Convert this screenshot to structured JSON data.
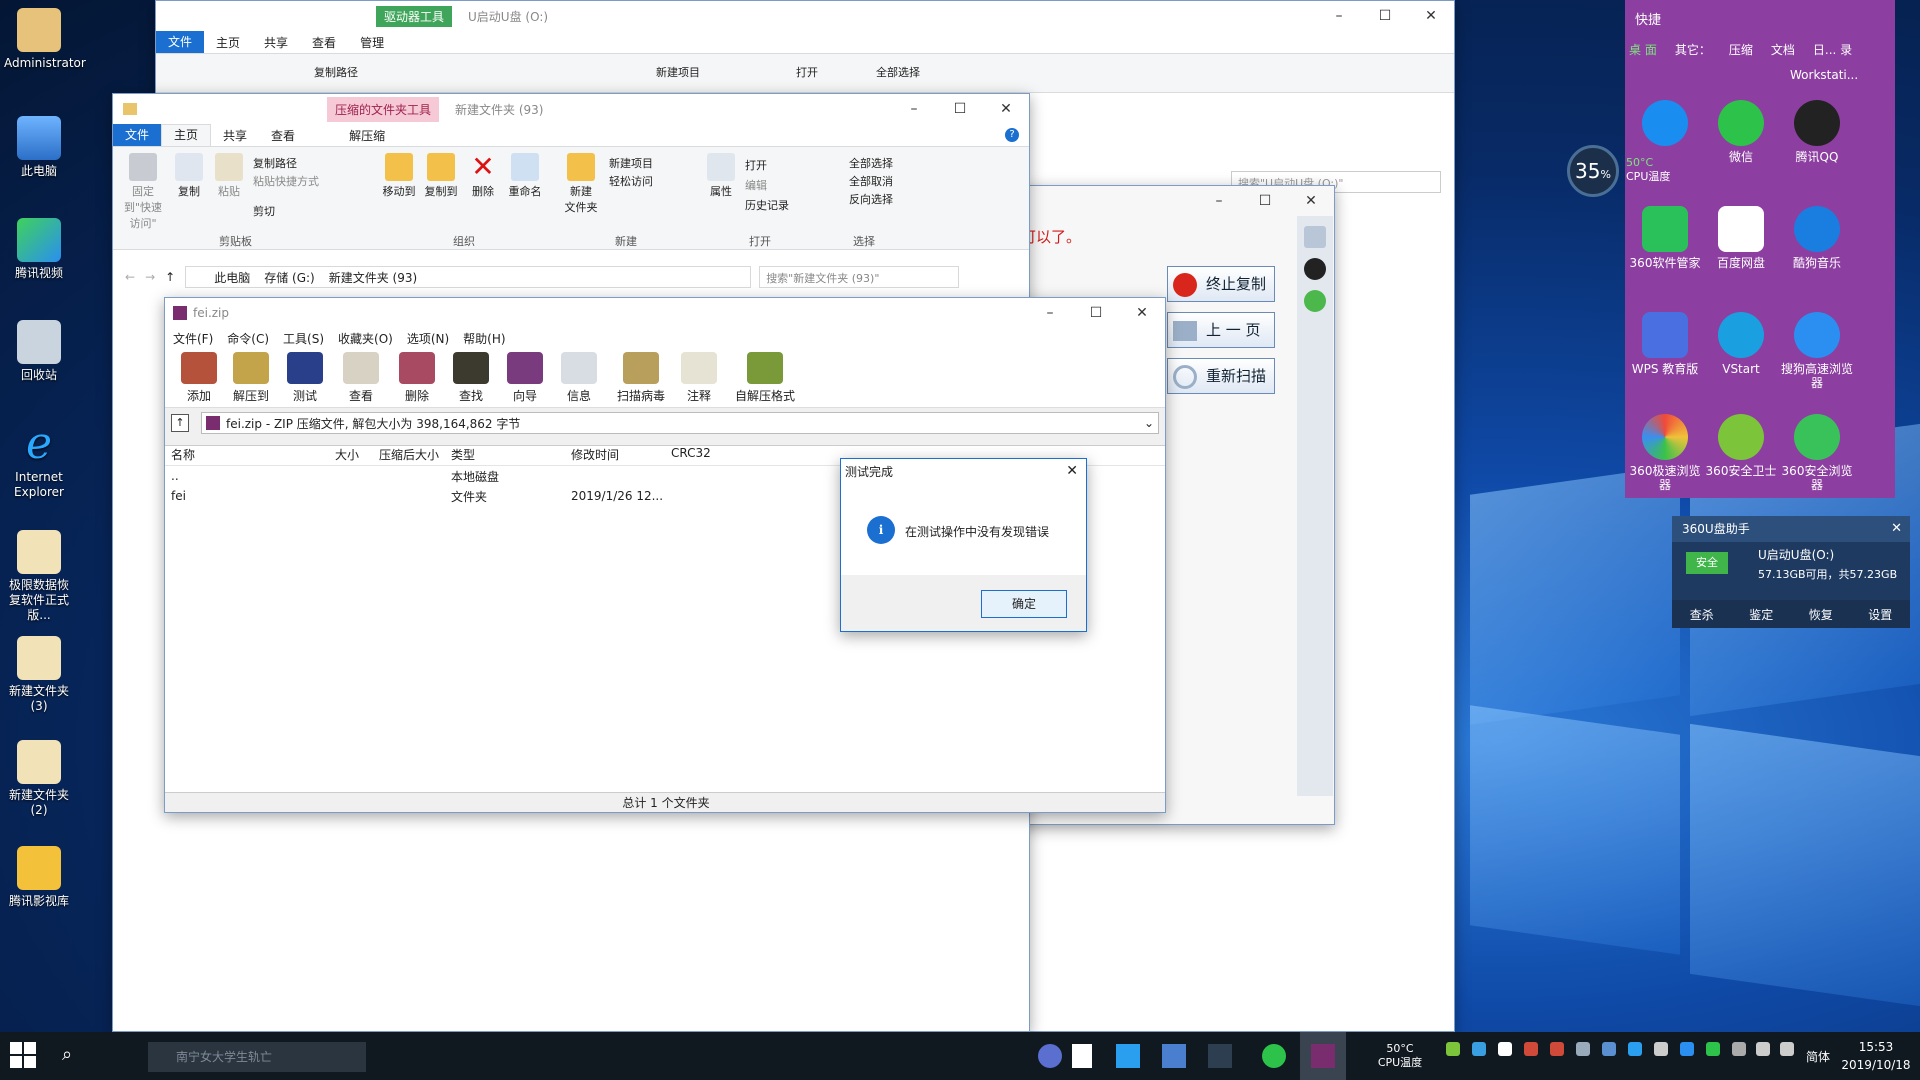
{
  "desktop": {
    "icons": [
      {
        "label": "Administrator"
      },
      {
        "label": "此电脑"
      },
      {
        "label": "腾讯视频"
      },
      {
        "label": "回收站"
      },
      {
        "label": "Internet Explorer"
      },
      {
        "label": "极限数据恢复软件正式版..."
      },
      {
        "label": "新建文件夹 (3)"
      },
      {
        "label": "新建文件夹 (2)"
      },
      {
        "label": "腾讯影视库"
      }
    ]
  },
  "back_explorer": {
    "tool_tab": "驱动器工具",
    "title": "U启动U盘 (O:)",
    "tabs": [
      "文件",
      "主页",
      "共享",
      "查看",
      "管理"
    ],
    "copy_path": "复制路径",
    "new_item": "新建项目",
    "open": "打开",
    "select_all": "全部选择",
    "search_placeholder": "搜索\"U启动U盘 (O:)\""
  },
  "explorer": {
    "tool_tab": "压缩的文件夹工具",
    "title": "新建文件夹 (93)",
    "tabs": [
      "文件",
      "主页",
      "共享",
      "查看",
      "解压缩"
    ],
    "clipboard": {
      "pin": "固定到\"快速访问\"",
      "copy": "复制",
      "paste": "粘贴",
      "copy_path": "复制路径",
      "paste_shortcut": "粘贴快捷方式",
      "cut": "剪切",
      "group": "剪贴板"
    },
    "organize": {
      "move_to": "移动到",
      "copy_to": "复制到",
      "delete": "删除",
      "rename": "重命名",
      "group": "组织"
    },
    "new": {
      "new_folder": "新建\n文件夹",
      "new_item": "新建项目",
      "easy_access": "轻松访问",
      "group": "新建"
    },
    "open": {
      "properties": "属性",
      "open": "打开",
      "edit": "编辑",
      "history": "历史记录",
      "group": "打开"
    },
    "select": {
      "select_all": "全部选择",
      "select_none": "全部取消",
      "invert": "反向选择",
      "group": "选择"
    },
    "breadcrumb": [
      "此电脑",
      "存储 (G:)",
      "新建文件夹 (93)"
    ],
    "search_placeholder": "搜索\"新建文件夹 (93)\""
  },
  "copier": {
    "message": "可以了。",
    "stop": "终止复制",
    "prev": "上 一 页",
    "rescan": "重新扫描"
  },
  "winrar": {
    "title": "fei.zip",
    "menu": [
      "文件(F)",
      "命令(C)",
      "工具(S)",
      "收藏夹(O)",
      "选项(N)",
      "帮助(H)"
    ],
    "toolbar": [
      "添加",
      "解压到",
      "测试",
      "查看",
      "删除",
      "查找",
      "向导",
      "信息",
      "扫描病毒",
      "注释",
      "自解压格式"
    ],
    "path": "fei.zip - ZIP 压缩文件, 解包大小为 398,164,862 字节",
    "columns": [
      "名称",
      "大小",
      "压缩后大小",
      "类型",
      "修改时间",
      "CRC32"
    ],
    "rows": [
      {
        "name": "..",
        "size": "",
        "packed": "",
        "type": "本地磁盘",
        "modified": "",
        "crc": ""
      },
      {
        "name": "fei",
        "size": "",
        "packed": "",
        "type": "文件夹",
        "modified": "2019/1/26 12...",
        "crc": ""
      }
    ],
    "status": "总计 1 个文件夹"
  },
  "dialog": {
    "title": "测试完成",
    "message": "在测试操作中没有发现错误",
    "ok": "确定"
  },
  "quick_panel": {
    "title": "快捷",
    "tabs": [
      "桌 面",
      "其它：",
      "压缩",
      "文档",
      "日... 录"
    ],
    "workstation": "Workstati...",
    "icons": [
      "",
      "微信",
      "腾讯QQ",
      "360软件管家",
      "百度网盘",
      "酷狗音乐",
      "WPS 教育版",
      "VStart",
      "搜狗高速浏览器",
      "360极速浏览器",
      "360安全卫士",
      "360安全浏览器"
    ]
  },
  "cpu_widget": {
    "percent": "35",
    "unit": "%",
    "temp": "50°C",
    "label": "CPU温度"
  },
  "usb_helper": {
    "title": "360U盘助手",
    "badge": "安全",
    "drive": "U启动U盘(O:)",
    "space": "57.13GB可用，共57.23GB",
    "actions": [
      "查杀",
      "鉴定",
      "恢复",
      "设置"
    ]
  },
  "taskbar": {
    "search_placeholder": "南宁女大学生轨亡",
    "temp": "50°C",
    "temp_label": "CPU温度",
    "ime": "简体",
    "time": "15:53",
    "date": "2019/10/18"
  }
}
